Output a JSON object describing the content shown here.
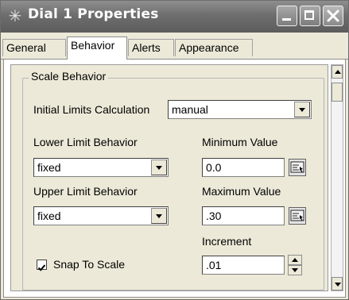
{
  "window": {
    "title": "Dial 1 Properties",
    "title_icon": "properties-icon",
    "minimize_icon": "minimize-icon",
    "maximize_icon": "maximize-icon",
    "close_icon": "close-icon"
  },
  "tabs": [
    {
      "label": "General",
      "active": false
    },
    {
      "label": "Behavior",
      "active": true
    },
    {
      "label": "Alerts",
      "active": false
    },
    {
      "label": "Appearance",
      "active": false
    }
  ],
  "group": {
    "legend": "Scale Behavior",
    "initial_limits": {
      "label": "Initial Limits Calculation",
      "value": "manual"
    },
    "lower_limit": {
      "label": "Lower Limit Behavior",
      "value": "fixed"
    },
    "upper_limit": {
      "label": "Upper Limit Behavior",
      "value": "fixed"
    },
    "minimum": {
      "label": "Minimum Value",
      "value": "0.0",
      "button_icon": "data-picker-icon"
    },
    "maximum": {
      "label": "Maximum Value",
      "value": ".30",
      "button_icon": "data-picker-icon"
    },
    "increment": {
      "label": "Increment",
      "value": ".01"
    },
    "snap_to_scale": {
      "label": "Snap To Scale",
      "checked": true
    }
  }
}
